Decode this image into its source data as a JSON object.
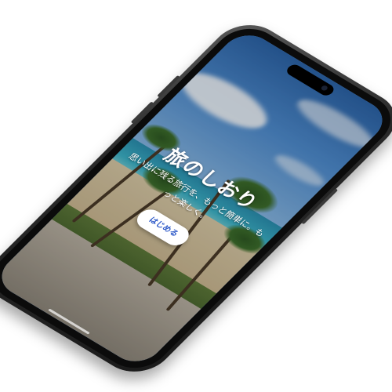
{
  "app": {
    "title": "旅のしおり",
    "subtitle": "思い出に残る旅行を、もっと簡単に。もっと楽しく。",
    "start_button_label": "はじめる"
  },
  "colors": {
    "accent": "#2c58c8",
    "button_background": "#ffffff",
    "text": "#ffffff",
    "phone_frame": "#1a1a1a"
  },
  "background": {
    "description_icon": "beach-photo"
  }
}
